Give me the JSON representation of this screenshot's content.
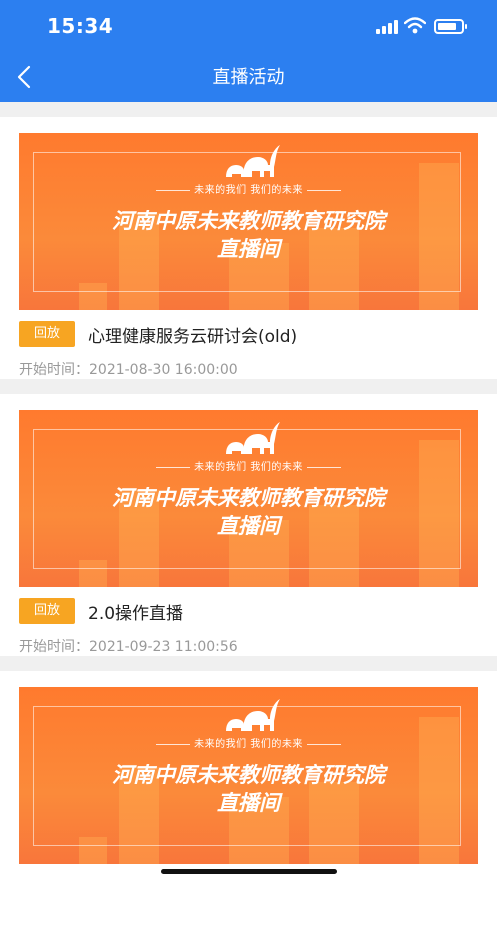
{
  "status_bar": {
    "time": "15:34"
  },
  "nav": {
    "title": "直播活动"
  },
  "banner": {
    "slogan": "未来的我们 我们的未来",
    "line1": "河南中原未来教师教育研究院",
    "line2": "直播间"
  },
  "activities": [
    {
      "tag": "回放",
      "title": "心理健康服务云研讨会(old)",
      "time_label": "开始时间：2021-08-30 16:00:00"
    },
    {
      "tag": "回放",
      "title": "2.0操作直播",
      "time_label": "开始时间：2021-09-23 11:00:56"
    },
    {
      "tag": "",
      "title": "",
      "time_label": ""
    }
  ],
  "colors": {
    "header": "#2c7ff0",
    "banner": "#ff7a2e",
    "tag": "#f7a522"
  }
}
